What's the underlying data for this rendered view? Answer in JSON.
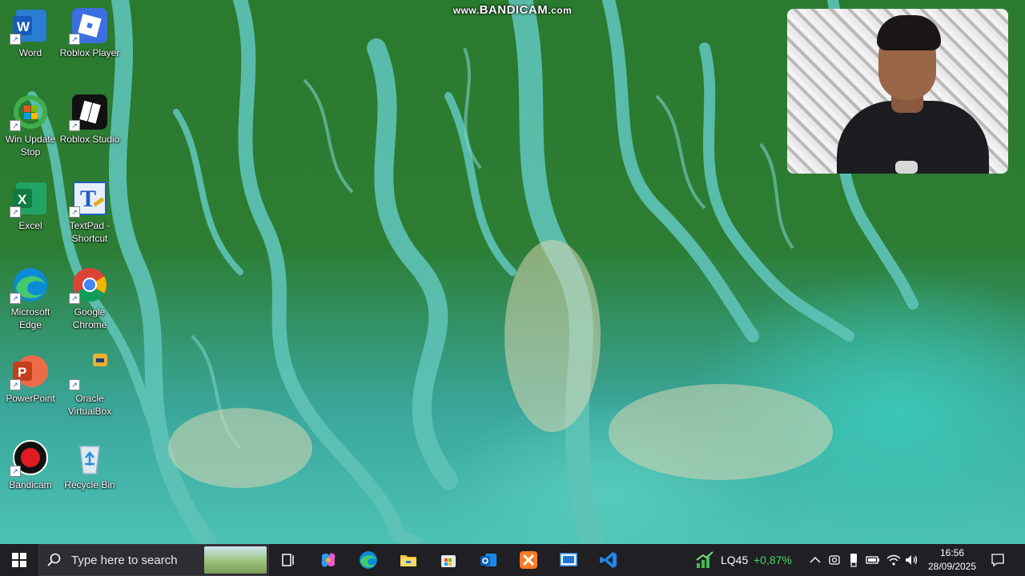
{
  "watermark": {
    "prefix": "www.",
    "brand": "BANDICAM",
    "suffix": ".com"
  },
  "desktop": {
    "icons": [
      {
        "label": "Word",
        "icon": "word-icon"
      },
      {
        "label": "Roblox Player",
        "icon": "roblox-player-icon"
      },
      {
        "label": "Win Update Stop",
        "icon": "win-update-stop-icon"
      },
      {
        "label": "Roblox Studio",
        "icon": "roblox-studio-icon"
      },
      {
        "label": "Excel",
        "icon": "excel-icon"
      },
      {
        "label": "TextPad - Shortcut",
        "icon": "textpad-icon"
      },
      {
        "label": "Microsoft Edge",
        "icon": "edge-icon"
      },
      {
        "label": "Google Chrome",
        "icon": "chrome-icon"
      },
      {
        "label": "PowerPoint",
        "icon": "powerpoint-icon"
      },
      {
        "label": "Oracle VirtualBox",
        "icon": "virtualbox-icon"
      },
      {
        "label": "Bandicam",
        "icon": "bandicam-icon"
      },
      {
        "label": "Recycle Bin",
        "icon": "recycle-bin-icon"
      }
    ]
  },
  "taskbar": {
    "search_placeholder": "Type here to search",
    "pinned_apps": [
      "task-view",
      "copilot",
      "edge",
      "file-explorer",
      "microsoft-store",
      "outlook",
      "xampp",
      "remote-desktop",
      "vscode"
    ],
    "stock": {
      "name": "LQ45",
      "change": "+0,87%"
    },
    "clock": {
      "time": "16:56",
      "date": "28/09/2025"
    }
  },
  "colors": {
    "taskbar_bg": "#1f1f24",
    "stock_positive": "#4cd964",
    "land_green": "#2c7d33",
    "water_teal": "#4cc2b5"
  }
}
